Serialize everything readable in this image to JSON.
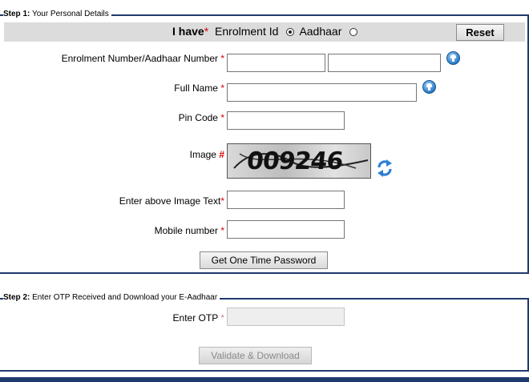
{
  "step1": {
    "legend_step": "Step 1:",
    "legend_text": " Your Personal Details",
    "have_label": "I have",
    "have_req": "*",
    "option_enrolment": "Enrolment Id",
    "option_aadhaar": "Aadhaar",
    "selected_option": "Enrolment Id",
    "reset_label": "Reset",
    "fields": {
      "enrolment_label": "Enrolment Number/Aadhaar Number",
      "fullname_label": "Full Name",
      "pincode_label": "Pin Code",
      "image_label": "Image",
      "image_marker": "#",
      "captcha_text": "009246",
      "image_text_label": "Enter above Image Text",
      "mobile_label": "Mobile number",
      "required_marker": "*"
    },
    "otp_button": "Get One Time Password"
  },
  "step2": {
    "legend_step": "Step 2:",
    "legend_text": " Enter OTP Received and Download your E-Aadhaar",
    "otp_label": "Enter OTP",
    "required_marker": "*",
    "validate_button": "Validate & Download"
  },
  "icons": {
    "help": "help-info-icon",
    "refresh": "refresh-captcha-icon"
  },
  "colors": {
    "border": "#1f3a6e",
    "required": "#d40000",
    "bar": "#dcdcdc"
  }
}
